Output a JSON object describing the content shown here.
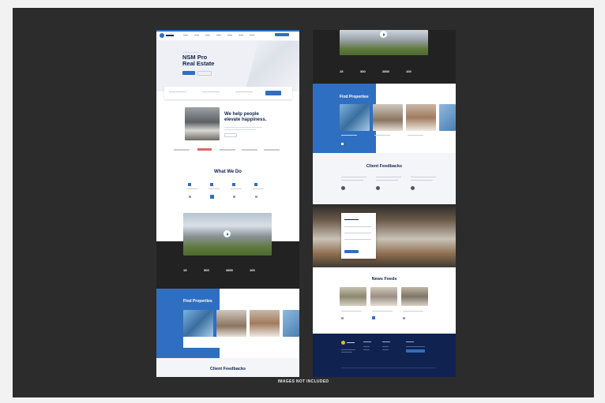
{
  "hero": {
    "title_line1": "NSM Pro",
    "title_line2": "Real Estate"
  },
  "about": {
    "heading_line1": "We help people",
    "heading_line2": "elevate happiness."
  },
  "sections": {
    "what_we_do": "What We Do",
    "find_properties": "Find Properties",
    "client_feedbacks": "Client Feedbacks",
    "news_feeds": "News Feeds"
  },
  "stats": [
    "15",
    "300",
    "2800",
    "100"
  ],
  "caption": "IMAGES NOT INCLUDED",
  "colors": {
    "accent": "#2f6fc1",
    "navy": "#0f2250",
    "backdrop": "#2c2c2c",
    "frame": "#f2f2f2"
  },
  "icons": [
    "play-icon",
    "logo-icon"
  ]
}
